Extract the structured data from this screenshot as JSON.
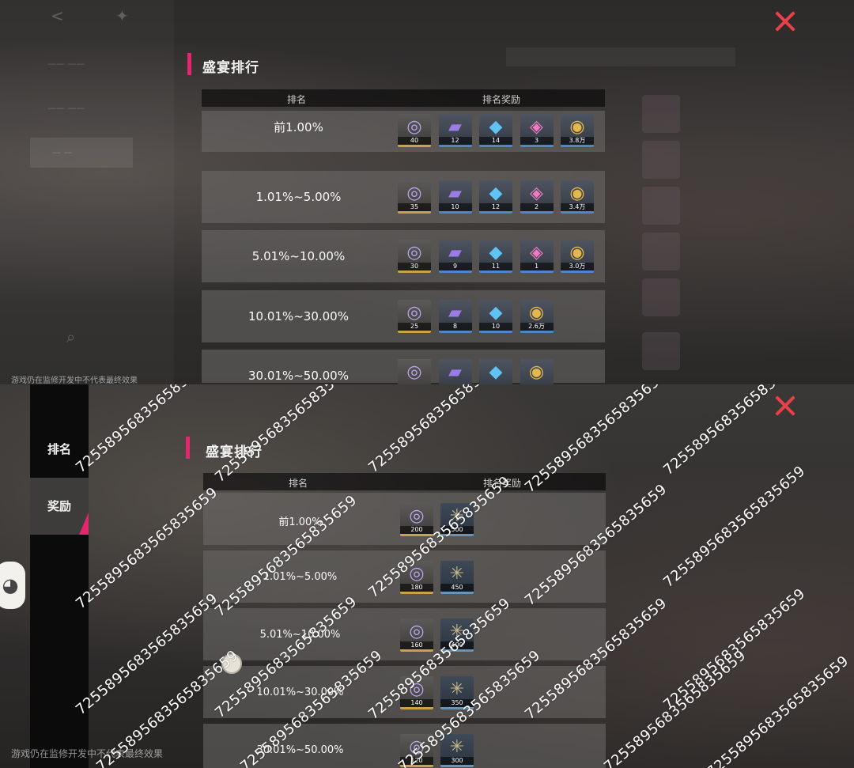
{
  "top": {
    "title": "盛宴排行",
    "header": {
      "rank": "排名",
      "reward": "排名奖励"
    },
    "rows": [
      {
        "rank": "前1.00%",
        "items": [
          {
            "icon": "ring-icon",
            "count": "40"
          },
          {
            "icon": "book-icon",
            "count": "12"
          },
          {
            "icon": "crystal-icon",
            "count": "14"
          },
          {
            "icon": "gift-box-icon",
            "count": "3"
          },
          {
            "icon": "coin-icon",
            "count": "3.8万"
          }
        ]
      },
      {
        "rank": "1.01%~5.00%",
        "items": [
          {
            "icon": "ring-icon",
            "count": "35"
          },
          {
            "icon": "book-icon",
            "count": "10"
          },
          {
            "icon": "crystal-icon",
            "count": "12"
          },
          {
            "icon": "gift-box-icon",
            "count": "2"
          },
          {
            "icon": "coin-icon",
            "count": "3.4万"
          }
        ]
      },
      {
        "rank": "5.01%~10.00%",
        "items": [
          {
            "icon": "ring-icon",
            "count": "30"
          },
          {
            "icon": "book-icon",
            "count": "9"
          },
          {
            "icon": "crystal-icon",
            "count": "11"
          },
          {
            "icon": "gift-box-icon",
            "count": "1"
          },
          {
            "icon": "coin-icon",
            "count": "3.0万"
          }
        ]
      },
      {
        "rank": "10.01%~30.00%",
        "items": [
          {
            "icon": "ring-icon",
            "count": "25"
          },
          {
            "icon": "book-icon",
            "count": "8"
          },
          {
            "icon": "crystal-icon",
            "count": "10"
          },
          {
            "icon": "coin-icon",
            "count": "2.6万"
          }
        ]
      },
      {
        "rank": "30.01%~50.00%",
        "items": [
          {
            "icon": "ring-icon",
            "count": ""
          },
          {
            "icon": "book-icon",
            "count": ""
          },
          {
            "icon": "crystal-icon",
            "count": ""
          },
          {
            "icon": "coin-icon",
            "count": ""
          }
        ]
      }
    ],
    "notice": "游戏仍在监修开发中不代表最终效果"
  },
  "bottom": {
    "title": "盛宴排行",
    "nav": [
      {
        "label": "排名"
      },
      {
        "label": "奖励"
      }
    ],
    "header": {
      "rank": "排名",
      "reward": "排名奖励"
    },
    "rows": [
      {
        "rank": "前1.00%",
        "items": [
          {
            "icon": "ring-icon",
            "count": "200"
          },
          {
            "icon": "net-icon",
            "count": "500"
          }
        ]
      },
      {
        "rank": "1.01%~5.00%",
        "items": [
          {
            "icon": "ring-icon",
            "count": "180"
          },
          {
            "icon": "net-icon",
            "count": "450"
          }
        ]
      },
      {
        "rank": "5.01%~10.00%",
        "items": [
          {
            "icon": "ring-icon",
            "count": "160"
          },
          {
            "icon": "net-icon",
            "count": "400"
          }
        ]
      },
      {
        "rank": "10.01%~30.00%",
        "items": [
          {
            "icon": "ring-icon",
            "count": "140"
          },
          {
            "icon": "net-icon",
            "count": "350"
          }
        ]
      },
      {
        "rank": "30.01%~50.00%",
        "items": [
          {
            "icon": "ring-icon",
            "count": "120"
          },
          {
            "icon": "net-icon",
            "count": "300"
          }
        ]
      }
    ],
    "notice": "游戏仍在监修开发中不代表最终效果",
    "watermark": "7255895683565835659"
  },
  "colors": {
    "accent": "#e3266e",
    "close": "#e9404a",
    "gold_border": "#c9a24a",
    "blue_border": "#4f86c9"
  }
}
